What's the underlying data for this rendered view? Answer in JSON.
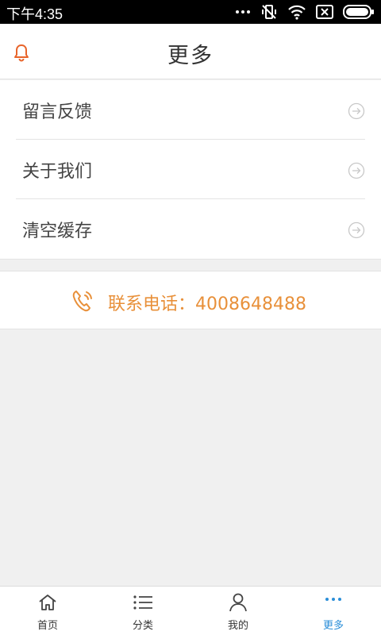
{
  "status_bar": {
    "time": "下午4:35"
  },
  "header": {
    "title": "更多"
  },
  "menu": {
    "items": [
      {
        "label": "留言反馈"
      },
      {
        "label": "关于我们"
      },
      {
        "label": "清空缓存"
      }
    ]
  },
  "contact": {
    "text": "联系电话：4008648488"
  },
  "tabbar": {
    "tabs": [
      {
        "label": "首页",
        "icon": "home-icon"
      },
      {
        "label": "分类",
        "icon": "list-icon"
      },
      {
        "label": "我的",
        "icon": "user-icon"
      },
      {
        "label": "更多",
        "icon": "more-dots-icon",
        "active": true
      }
    ]
  },
  "colors": {
    "accent": "#e8903a",
    "active_tab": "#2a8ed8",
    "bell": "#e8642a"
  }
}
